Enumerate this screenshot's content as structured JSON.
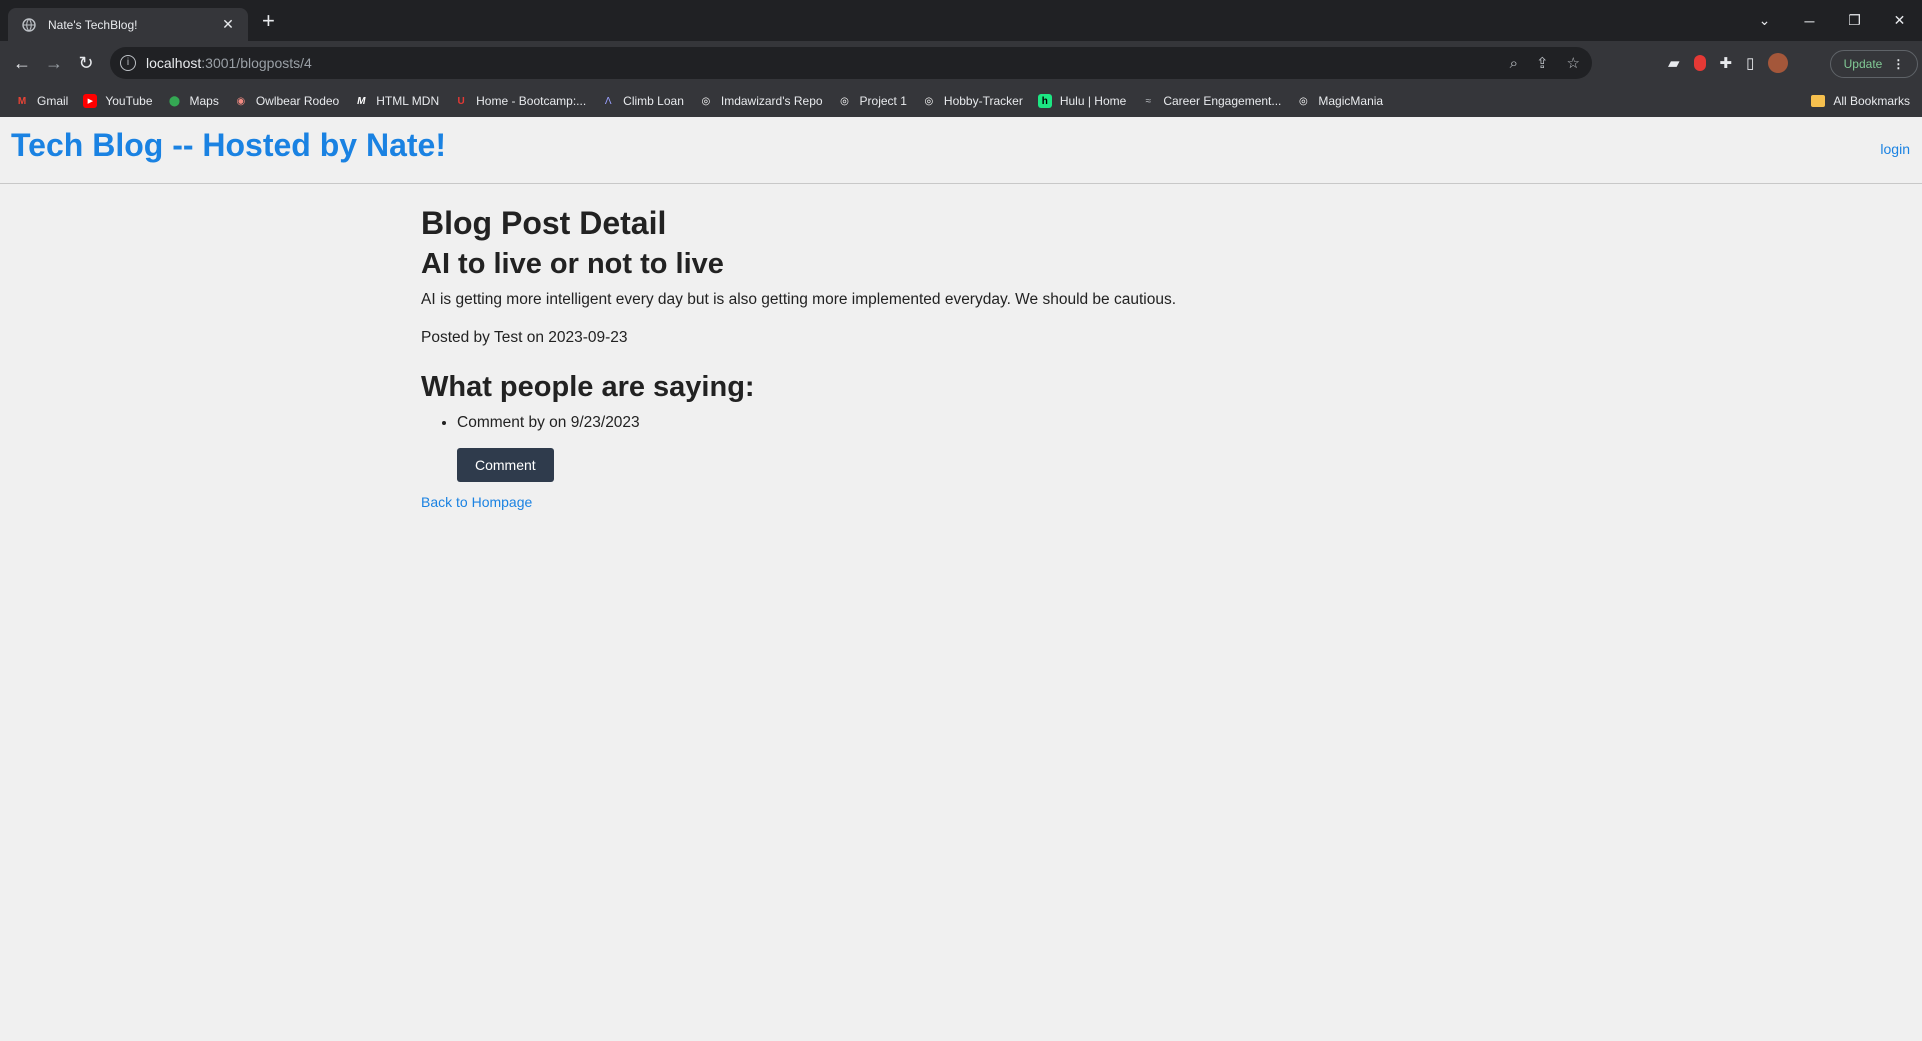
{
  "browser": {
    "tab_title": "Nate's TechBlog!",
    "url_host": "localhost",
    "url_path": ":3001/blogposts/4",
    "update_label": "Update",
    "bookmarks": [
      {
        "label": "Gmail",
        "icon": "gmail-icon"
      },
      {
        "label": "YouTube",
        "icon": "youtube-icon"
      },
      {
        "label": "Maps",
        "icon": "maps-icon"
      },
      {
        "label": "Owlbear Rodeo",
        "icon": "owlbear-icon"
      },
      {
        "label": "HTML MDN",
        "icon": "mdn-icon"
      },
      {
        "label": "Home - Bootcamp:...",
        "icon": "bootcamp-icon"
      },
      {
        "label": "Climb Loan",
        "icon": "climb-icon"
      },
      {
        "label": "Imdawizard's Repo",
        "icon": "github-icon"
      },
      {
        "label": "Project 1",
        "icon": "github-icon"
      },
      {
        "label": "Hobby-Tracker",
        "icon": "github-icon"
      },
      {
        "label": "Hulu | Home",
        "icon": "hulu-icon"
      },
      {
        "label": "Career Engagement...",
        "icon": "career-icon"
      },
      {
        "label": "MagicMania",
        "icon": "github-icon"
      }
    ],
    "all_bookmarks_label": "All Bookmarks"
  },
  "site": {
    "title": "Tech Blog -- Hosted by Nate!",
    "login_label": "login"
  },
  "post": {
    "heading": "Blog Post Detail",
    "title": "AI to live or not to live",
    "body": "AI is getting more intelligent every day but is also getting more implemented everyday. We should be cautious.",
    "meta": "Posted by Test on 2023-09-23",
    "comments_heading": "What people are saying:",
    "comments": [
      "Comment by on 9/23/2023"
    ],
    "comment_button": "Comment",
    "back_link": "Back to Hompage"
  },
  "colors": {
    "link_blue": "#1a82e2",
    "button_dark": "#2f3b4c",
    "page_bg": "#f0f0f0"
  }
}
